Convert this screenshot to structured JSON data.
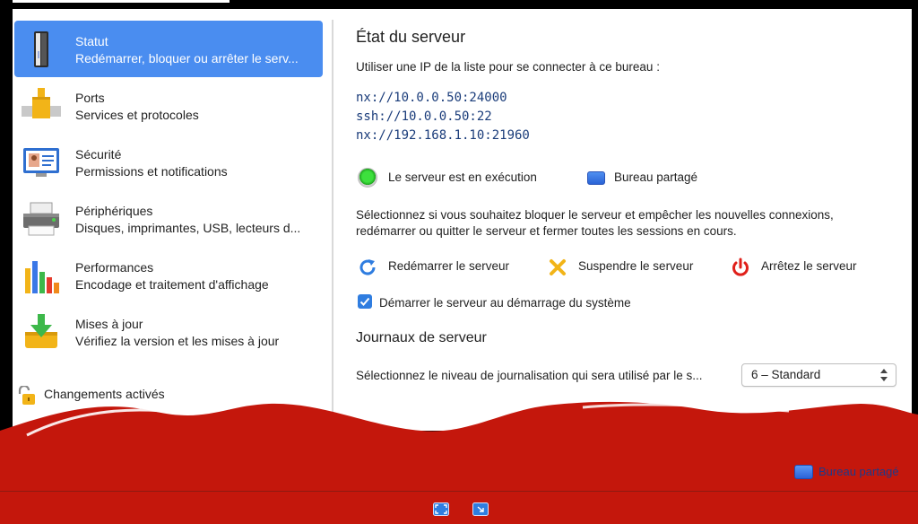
{
  "sidebar": {
    "items": [
      {
        "title": "Statut",
        "subtitle": "Redémarrer, bloquer ou arrêter le serv...",
        "icon": "server-tower-icon",
        "selected": true
      },
      {
        "title": "Ports",
        "subtitle": "Services et protocoles",
        "icon": "ports-pipe-icon"
      },
      {
        "title": "Sécurité",
        "subtitle": "Permissions et notifications",
        "icon": "id-card-monitor-icon"
      },
      {
        "title": "Périphériques",
        "subtitle": "Disques, imprimantes, USB, lecteurs d...",
        "icon": "printer-icon"
      },
      {
        "title": "Performances",
        "subtitle": "Encodage et traitement d'affichage",
        "icon": "bar-chart-icon"
      },
      {
        "title": "Mises à jour",
        "subtitle": "Vérifiez la version et les mises à jour",
        "icon": "download-tray-icon"
      }
    ],
    "lock_label": "Changements activés"
  },
  "main": {
    "title": "État du serveur",
    "ip_intro": "Utiliser une IP de la liste pour se connecter à ce bureau :",
    "ips": [
      "nx://10.0.0.50:24000",
      "ssh://10.0.0.50:22",
      "nx://192.168.1.10:21960"
    ],
    "running_label": "Le serveur est en exécution",
    "shared_label": "Bureau partagé",
    "description_line1": "Sélectionnez si vous souhaitez bloquer le serveur et empêcher les nouvelles connexions,",
    "description_line2": "redémarrer ou quitter le serveur et fermer toutes les sessions en cours.",
    "actions": {
      "restart": "Redémarrer le serveur",
      "suspend": "Suspendre le serveur",
      "stop": "Arrêtez le serveur"
    },
    "autostart_label": "Démarrer le serveur au démarrage du système",
    "autostart_checked": true,
    "logs_title": "Journaux de serveur",
    "log_level_prompt": "Sélectionnez le niveau de journalisation qui sera utilisé par le s...",
    "log_level_value": "6 – Standard"
  },
  "overlay": {
    "shared_label": "Bureau partagé"
  },
  "colors": {
    "accent": "#4a8df0",
    "wave_red": "#c4170c",
    "status_green": "#2bc52b"
  }
}
